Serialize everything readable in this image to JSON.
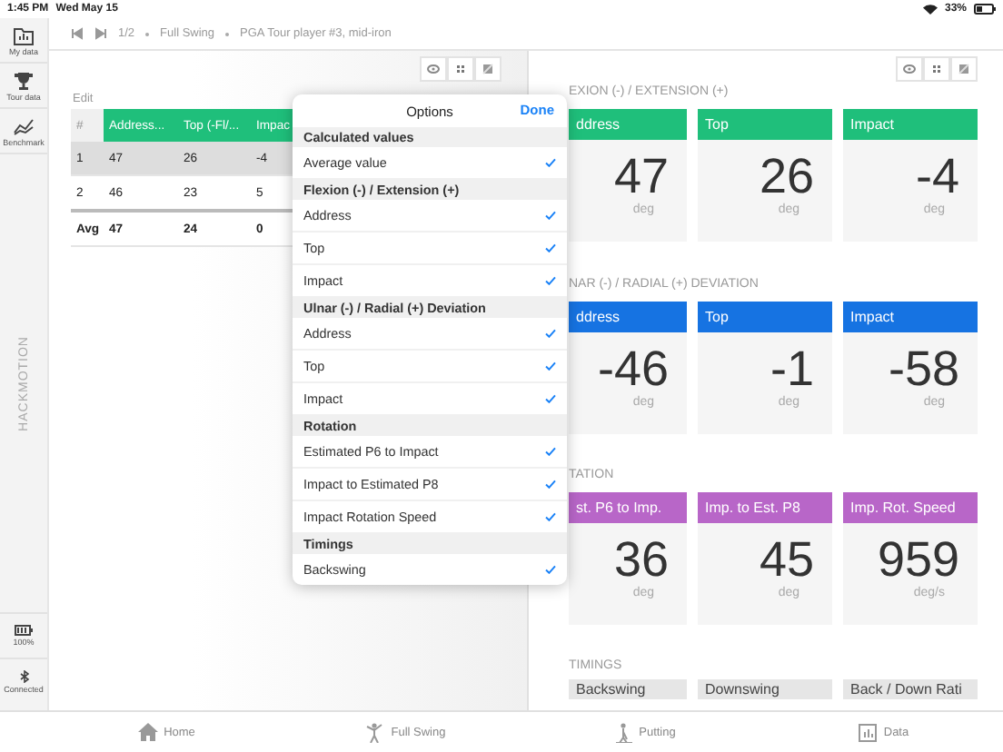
{
  "status_bar": {
    "time": "1:45 PM",
    "date": "Wed May 15",
    "battery": "33%"
  },
  "sidebar": {
    "items": [
      {
        "label": "My data"
      },
      {
        "label": "Tour data"
      },
      {
        "label": "Benchmark"
      }
    ],
    "brand": "HACKMOTION",
    "battery": "100%",
    "connection": "Connected"
  },
  "nav": {
    "position": "1/2",
    "mode": "Full Swing",
    "title": "PGA Tour player #3, mid-iron"
  },
  "table": {
    "edit": "Edit",
    "columns": [
      "#",
      "Address...",
      "Top (-Fl/...",
      "Impac"
    ],
    "rows": [
      {
        "cells": [
          "1",
          "47",
          "26",
          "-4"
        ],
        "selected": true
      },
      {
        "cells": [
          "2",
          "46",
          "23",
          "5"
        ],
        "selected": false
      }
    ],
    "footer": [
      "Avg",
      "47",
      "24",
      "0"
    ]
  },
  "options": {
    "title": "Options",
    "done": "Done",
    "groups": [
      {
        "title": "Calculated values",
        "items": [
          {
            "label": "Average value",
            "checked": true
          }
        ]
      },
      {
        "title": "Flexion (-) / Extension (+)",
        "items": [
          {
            "label": "Address",
            "checked": true
          },
          {
            "label": "Top",
            "checked": true
          },
          {
            "label": "Impact",
            "checked": true
          }
        ]
      },
      {
        "title": "Ulnar (-) / Radial (+) Deviation",
        "items": [
          {
            "label": "Address",
            "checked": true
          },
          {
            "label": "Top",
            "checked": true
          },
          {
            "label": "Impact",
            "checked": true
          }
        ]
      },
      {
        "title": "Rotation",
        "items": [
          {
            "label": "Estimated P6 to Impact",
            "checked": true
          },
          {
            "label": "Impact to Estimated P8",
            "checked": true
          },
          {
            "label": "Impact Rotation Speed",
            "checked": true
          }
        ]
      },
      {
        "title": "Timings",
        "items": [
          {
            "label": "Backswing",
            "checked": true
          }
        ]
      }
    ]
  },
  "sections": [
    {
      "title": "EXION (-) / EXTENSION (+)",
      "color": "#1fbf7b",
      "cards": [
        {
          "label": "ddress",
          "value": "47",
          "unit": "deg"
        },
        {
          "label": "Top",
          "value": "26",
          "unit": "deg"
        },
        {
          "label": "Impact",
          "value": "-4",
          "unit": "deg"
        }
      ]
    },
    {
      "title": "NAR (-) / RADIAL (+) DEVIATION",
      "color": "#1673e2",
      "cards": [
        {
          "label": "ddress",
          "value": "-46",
          "unit": "deg"
        },
        {
          "label": "Top",
          "value": "-1",
          "unit": "deg"
        },
        {
          "label": "Impact",
          "value": "-58",
          "unit": "deg"
        }
      ]
    },
    {
      "title": "TATION",
      "color": "#b866c8",
      "cards": [
        {
          "label": "st. P6 to Imp.",
          "value": "36",
          "unit": "deg"
        },
        {
          "label": "Imp. to Est. P8",
          "value": "45",
          "unit": "deg"
        },
        {
          "label": "Imp. Rot. Speed",
          "value": "959",
          "unit": "deg/s"
        }
      ]
    },
    {
      "title": "TIMINGS",
      "color": "#e6e6e6",
      "cards": [
        {
          "label": "Backswing"
        },
        {
          "label": "Downswing"
        },
        {
          "label": "Back / Down Rati"
        }
      ]
    }
  ],
  "tab_bar": [
    {
      "label": "Home"
    },
    {
      "label": "Full Swing"
    },
    {
      "label": "Putting"
    },
    {
      "label": "Data"
    }
  ]
}
